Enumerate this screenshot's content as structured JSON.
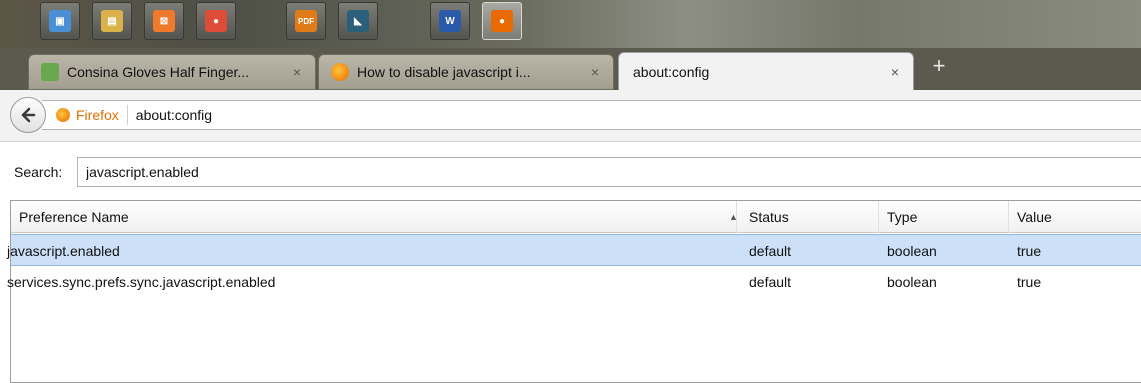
{
  "taskbar": {
    "buttons": [
      {
        "icon": "monitor-icon",
        "color": "#4a8fd6",
        "glyph": "▣"
      },
      {
        "icon": "file-explorer-icon",
        "color": "#d9b24a",
        "glyph": "▤"
      },
      {
        "icon": "xampp-icon",
        "color": "#f07a2b",
        "glyph": "⊠"
      },
      {
        "icon": "chrome-icon",
        "color": "#dd4b39",
        "glyph": "●"
      },
      {
        "icon": "pdf-icon",
        "color": "#e07b1a",
        "glyph": "PDF"
      },
      {
        "icon": "dreamweaver-icon",
        "color": "#2b5f7a",
        "glyph": "◣"
      },
      {
        "icon": "word-icon",
        "color": "#2a5aa8",
        "glyph": "W"
      },
      {
        "icon": "firefox-icon",
        "color": "#e76b00",
        "glyph": "●"
      }
    ]
  },
  "tabs": [
    {
      "title": "Consina Gloves Half Finger...",
      "close": "×",
      "icon": "consina-favicon",
      "color": "#6aa84f"
    },
    {
      "title": "How to disable javascript i...",
      "close": "×",
      "icon": "firefox-favicon",
      "color": "#e76b00"
    },
    {
      "title": "about:config",
      "close": "×",
      "icon": "",
      "color": ""
    }
  ],
  "newtab_label": "+",
  "nav": {
    "identity_label": "Firefox",
    "url": "about:config"
  },
  "search": {
    "label": "Search:",
    "value": "javascript.enabled"
  },
  "table": {
    "columns": [
      "Preference Name",
      "Status",
      "Type",
      "Value"
    ],
    "sort_indicator": "▲",
    "rows": [
      {
        "name": "javascript.enabled",
        "status": "default",
        "type": "boolean",
        "value": "true",
        "selected": true
      },
      {
        "name": "services.sync.prefs.sync.javascript.enabled",
        "status": "default",
        "type": "boolean",
        "value": "true",
        "selected": false
      }
    ]
  }
}
